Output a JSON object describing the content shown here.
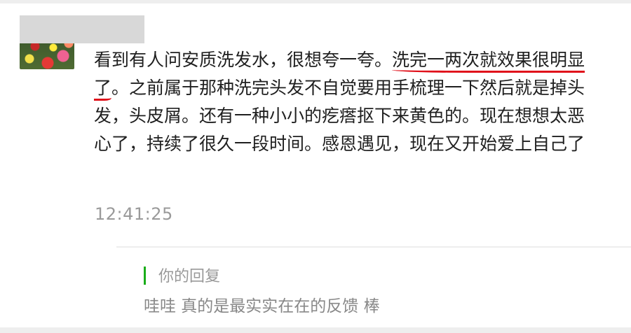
{
  "comment": {
    "text_before": "看到有人问安质洗发水，很想夸一夸。",
    "highlight": "洗完一两次就效果很明显了",
    "text_after": "。之前属于那种洗完头发不自觉要用手梳理一下然后就是掉头发，头皮屑。还有一种小小的疙瘩抠下来黄色的。现在想想太恶心了，持续了很久一段时间。感恩遇见，现在又开始爱上自己了",
    "time": "12:41:25",
    "highlight_color": "#e0101a"
  },
  "reply": {
    "label": "你的回复",
    "text": "哇哇 真的是最实实在在的反馈 棒",
    "accent_color": "#1aad19"
  }
}
